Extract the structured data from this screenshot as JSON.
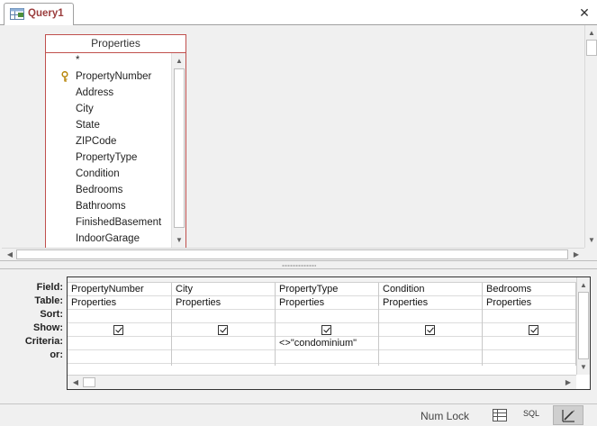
{
  "tab": {
    "label": "Query1",
    "icon": "query-icon"
  },
  "window": {
    "close_symbol": "✕"
  },
  "table": {
    "title": "Properties",
    "fields": [
      "*",
      "PropertyNumber",
      "Address",
      "City",
      "State",
      "ZIPCode",
      "PropertyType",
      "Condition",
      "Bedrooms",
      "Bathrooms",
      "FinishedBasement",
      "IndoorGarage"
    ],
    "primary_key_field": "PropertyNumber"
  },
  "grid": {
    "row_labels": {
      "field": "Field:",
      "table": "Table:",
      "sort": "Sort:",
      "show": "Show:",
      "criteria": "Criteria:",
      "or": "or:"
    },
    "columns": [
      {
        "field": "PropertyNumber",
        "table": "Properties",
        "sort": "",
        "show": true,
        "criteria": "",
        "or": ""
      },
      {
        "field": "City",
        "table": "Properties",
        "sort": "",
        "show": true,
        "criteria": "",
        "or": ""
      },
      {
        "field": "PropertyType",
        "table": "Properties",
        "sort": "",
        "show": true,
        "criteria": "<>\"condominium\"",
        "or": ""
      },
      {
        "field": "Condition",
        "table": "Properties",
        "sort": "",
        "show": true,
        "criteria": "",
        "or": ""
      },
      {
        "field": "Bedrooms",
        "table": "Properties",
        "sort": "",
        "show": true,
        "criteria": "",
        "or": ""
      }
    ]
  },
  "statusbar": {
    "num_lock": "Num Lock",
    "sql_label": "SQL",
    "active_view": "design"
  },
  "colors": {
    "accent": "#9b3d3d",
    "table_border": "#c0504d"
  }
}
